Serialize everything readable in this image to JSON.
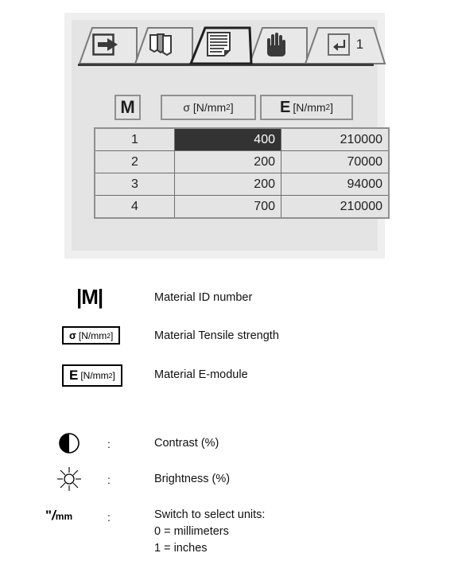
{
  "app": {
    "tabs": [
      {
        "id": "tab-export",
        "icon": "arrow-into-box-icon",
        "label": ""
      },
      {
        "id": "tab-sheets",
        "icon": "stacked-pages-icon",
        "label": ""
      },
      {
        "id": "tab-document",
        "icon": "document-lines-icon",
        "label": "",
        "active": true
      },
      {
        "id": "tab-hand",
        "icon": "hand-icon",
        "label": ""
      },
      {
        "id": "tab-enter",
        "icon": "enter-return-icon",
        "label": "1"
      }
    ]
  },
  "table": {
    "headers": {
      "m": "M",
      "sigma_symbol": "σ",
      "sigma_unit": "[N/mm",
      "sigma_sup": "2",
      "sigma_close": "]",
      "e_symbol": "E",
      "e_unit": "[N/mm",
      "e_sup": "2",
      "e_close": "]"
    },
    "rows": [
      {
        "m": "1",
        "sigma": "400",
        "e": "210000",
        "selected": "sigma"
      },
      {
        "m": "2",
        "sigma": "200",
        "e": "70000",
        "selected": ""
      },
      {
        "m": "3",
        "sigma": "200",
        "e": "94000",
        "selected": ""
      },
      {
        "m": "4",
        "sigma": "700",
        "e": "210000",
        "selected": ""
      }
    ]
  },
  "legend": {
    "items": [
      {
        "id": "material-id",
        "symbol_kind": "m-bars",
        "symbol_text": "|M|",
        "colon": "",
        "description": "Material ID number"
      },
      {
        "id": "tensile-strength",
        "symbol_kind": "unit-box",
        "symbol_main": "σ",
        "symbol_unit": "[N/mm",
        "symbol_sup": "2",
        "symbol_close": "]",
        "colon": "",
        "description": "Material Tensile strength"
      },
      {
        "id": "e-module",
        "symbol_kind": "unit-box-e",
        "symbol_main": "E",
        "symbol_unit": "[N/mm",
        "symbol_sup": "2",
        "symbol_close": "]",
        "colon": "",
        "description": "Material E-module"
      },
      {
        "id": "contrast",
        "symbol_kind": "contrast-icon",
        "colon": ":",
        "description": "Contrast (%)"
      },
      {
        "id": "brightness",
        "symbol_kind": "brightness-icon",
        "colon": ":",
        "description": "Brightness (%)"
      },
      {
        "id": "units-switch",
        "symbol_kind": "units-glyph",
        "symbol_inch": "\"",
        "symbol_slash": "/",
        "symbol_mm": "mm",
        "colon": ":",
        "description": "Switch to select units:\n0 = millimeters\n1 = inches"
      }
    ]
  },
  "colors": {
    "panel_outer": "#efefef",
    "panel_inner": "#e4e4e4",
    "selection": "#333333",
    "border": "#6e6e6e",
    "icon": "#3a3a3a"
  }
}
